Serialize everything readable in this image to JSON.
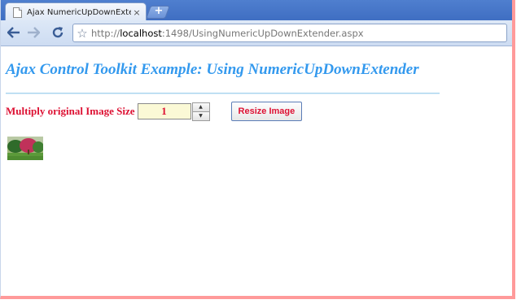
{
  "browser": {
    "tab": {
      "title": "Ajax NumericUpDownExten...",
      "close_glyph": "×"
    },
    "new_tab_glyph": "+",
    "nav": {
      "back_icon": "back-arrow-icon",
      "forward_icon": "forward-arrow-icon",
      "reload_icon": "reload-icon"
    },
    "omnibox": {
      "star_icon": "bookmark-star-icon",
      "url_scheme": "http://",
      "url_host": "localhost",
      "url_rest": ":1498/UsingNumericUpDownExtender.aspx"
    }
  },
  "page": {
    "title": "Ajax Control Toolkit Example: Using NumericUpDownExtender",
    "size_label": "Multiply original Image Size",
    "size_value": "1",
    "resize_button": "Resize Image",
    "image_icon": "tree-landscape-image"
  },
  "colors": {
    "title": "#3399ee",
    "label": "#dd1133",
    "input_bg": "#fbf9d6",
    "window_border": "#ff9a9a"
  }
}
